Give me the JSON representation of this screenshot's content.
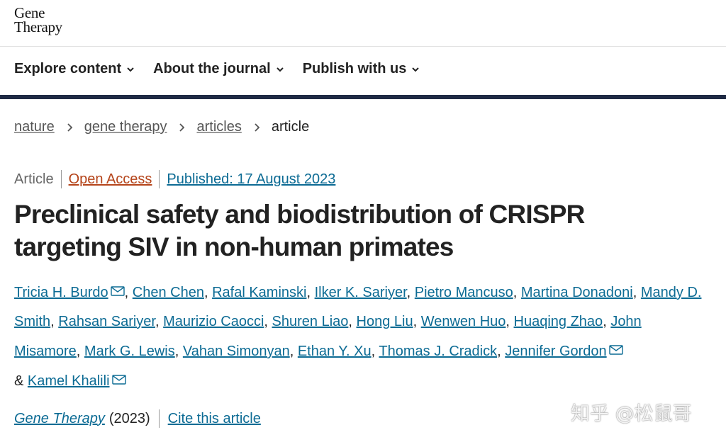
{
  "logo": {
    "line1": "Gene",
    "line2": "Therapy"
  },
  "nav": {
    "items": [
      {
        "label": "Explore content"
      },
      {
        "label": "About the journal"
      },
      {
        "label": "Publish with us"
      }
    ]
  },
  "breadcrumb": {
    "items": [
      "nature",
      "gene therapy",
      "articles"
    ],
    "current": "article"
  },
  "meta": {
    "type": "Article",
    "access": "Open Access",
    "published": "Published: 17 August 2023"
  },
  "article": {
    "title_line1": "Preclinical safety and biodistribution of CRISPR",
    "title_line2": "targeting SIV in non-human primates"
  },
  "authors": [
    "Tricia H. Burdo",
    "Chen Chen",
    "Rafal Kaminski",
    "Ilker K. Sariyer",
    "Pietro Mancuso",
    "Martina Donadoni",
    "Mandy D. Smith",
    "Rahsan Sariyer",
    "Maurizio Caocci",
    "Shuren Liao",
    "Hong Liu",
    "Wenwen Huo",
    "Huaqing Zhao",
    "John Misamore",
    "Mark G. Lewis",
    "Vahan Simonyan",
    "Ethan Y. Xu",
    "Thomas J. Cradick",
    "Jennifer Gordon",
    "Kamel Khalili"
  ],
  "authors_joiner": "&",
  "footer": {
    "journal": "Gene Therapy",
    "year": "(2023)",
    "cite": "Cite this article"
  },
  "watermark": "知乎 @松鼠哥",
  "colors": {
    "link": "#0c6b94",
    "open_access": "#b5451b",
    "navbar_rule": "#1f2a44"
  }
}
